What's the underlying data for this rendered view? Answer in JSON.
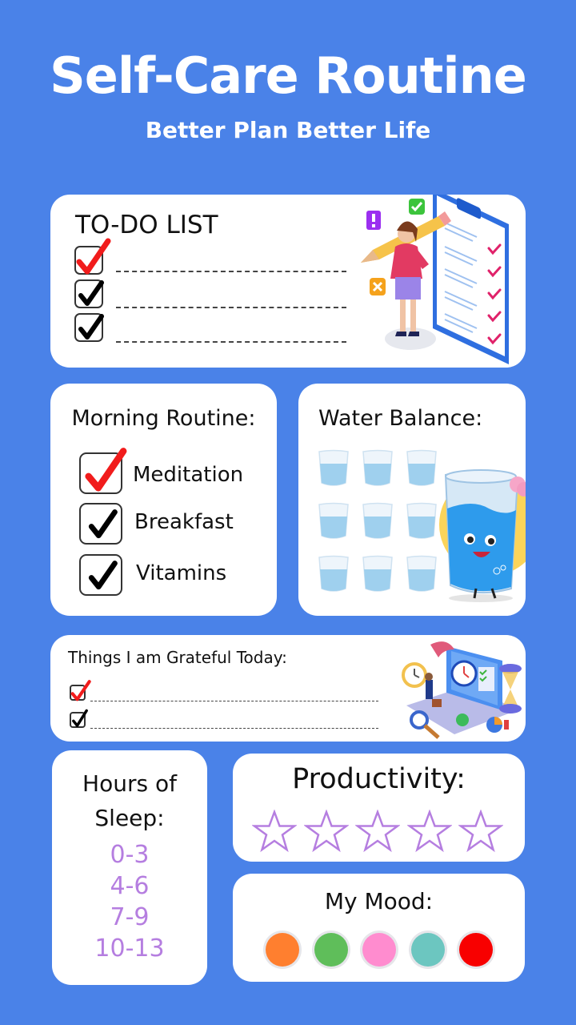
{
  "header": {
    "title": "Self-Care Routine",
    "subtitle": "Better Plan Better Life"
  },
  "todo": {
    "title": "TO-DO LIST",
    "items": [
      {
        "checked": true,
        "check_color": "red",
        "text": ""
      },
      {
        "checked": true,
        "check_color": "black",
        "text": ""
      },
      {
        "checked": true,
        "check_color": "black",
        "text": ""
      }
    ],
    "illustration": "woman-with-pencil-and-checklist-clipboard"
  },
  "morning_routine": {
    "title": "Morning Routine:",
    "items": [
      {
        "label": "Meditation",
        "checked": true,
        "check_color": "red"
      },
      {
        "label": "Breakfast",
        "checked": true,
        "check_color": "black"
      },
      {
        "label": "Vitamins",
        "checked": true,
        "check_color": "black"
      }
    ]
  },
  "water_balance": {
    "title": "Water Balance:",
    "glass_count": 9,
    "illustration": "smiling-water-glass-mascot"
  },
  "grateful": {
    "title": "Things I am Grateful Today:",
    "items": [
      {
        "checked": true,
        "check_color": "red",
        "text": ""
      },
      {
        "checked": true,
        "check_color": "black",
        "text": ""
      }
    ],
    "illustration": "laptop-time-management"
  },
  "sleep": {
    "title_line1": "Hours of",
    "title_line2": "Sleep:",
    "options": [
      "0-3",
      "4-6",
      "7-9",
      "10-13"
    ]
  },
  "productivity": {
    "title": "Productivity:",
    "max_stars": 5,
    "rating": 0
  },
  "mood": {
    "title": "My Mood:",
    "colors": [
      "#ff7f2f",
      "#5fbe5a",
      "#ff8ccf",
      "#6cc6c0",
      "#f80000"
    ]
  },
  "colors": {
    "background": "#4a82e8",
    "accent_purple": "#b57ee0",
    "check_red": "#f11c1c"
  }
}
